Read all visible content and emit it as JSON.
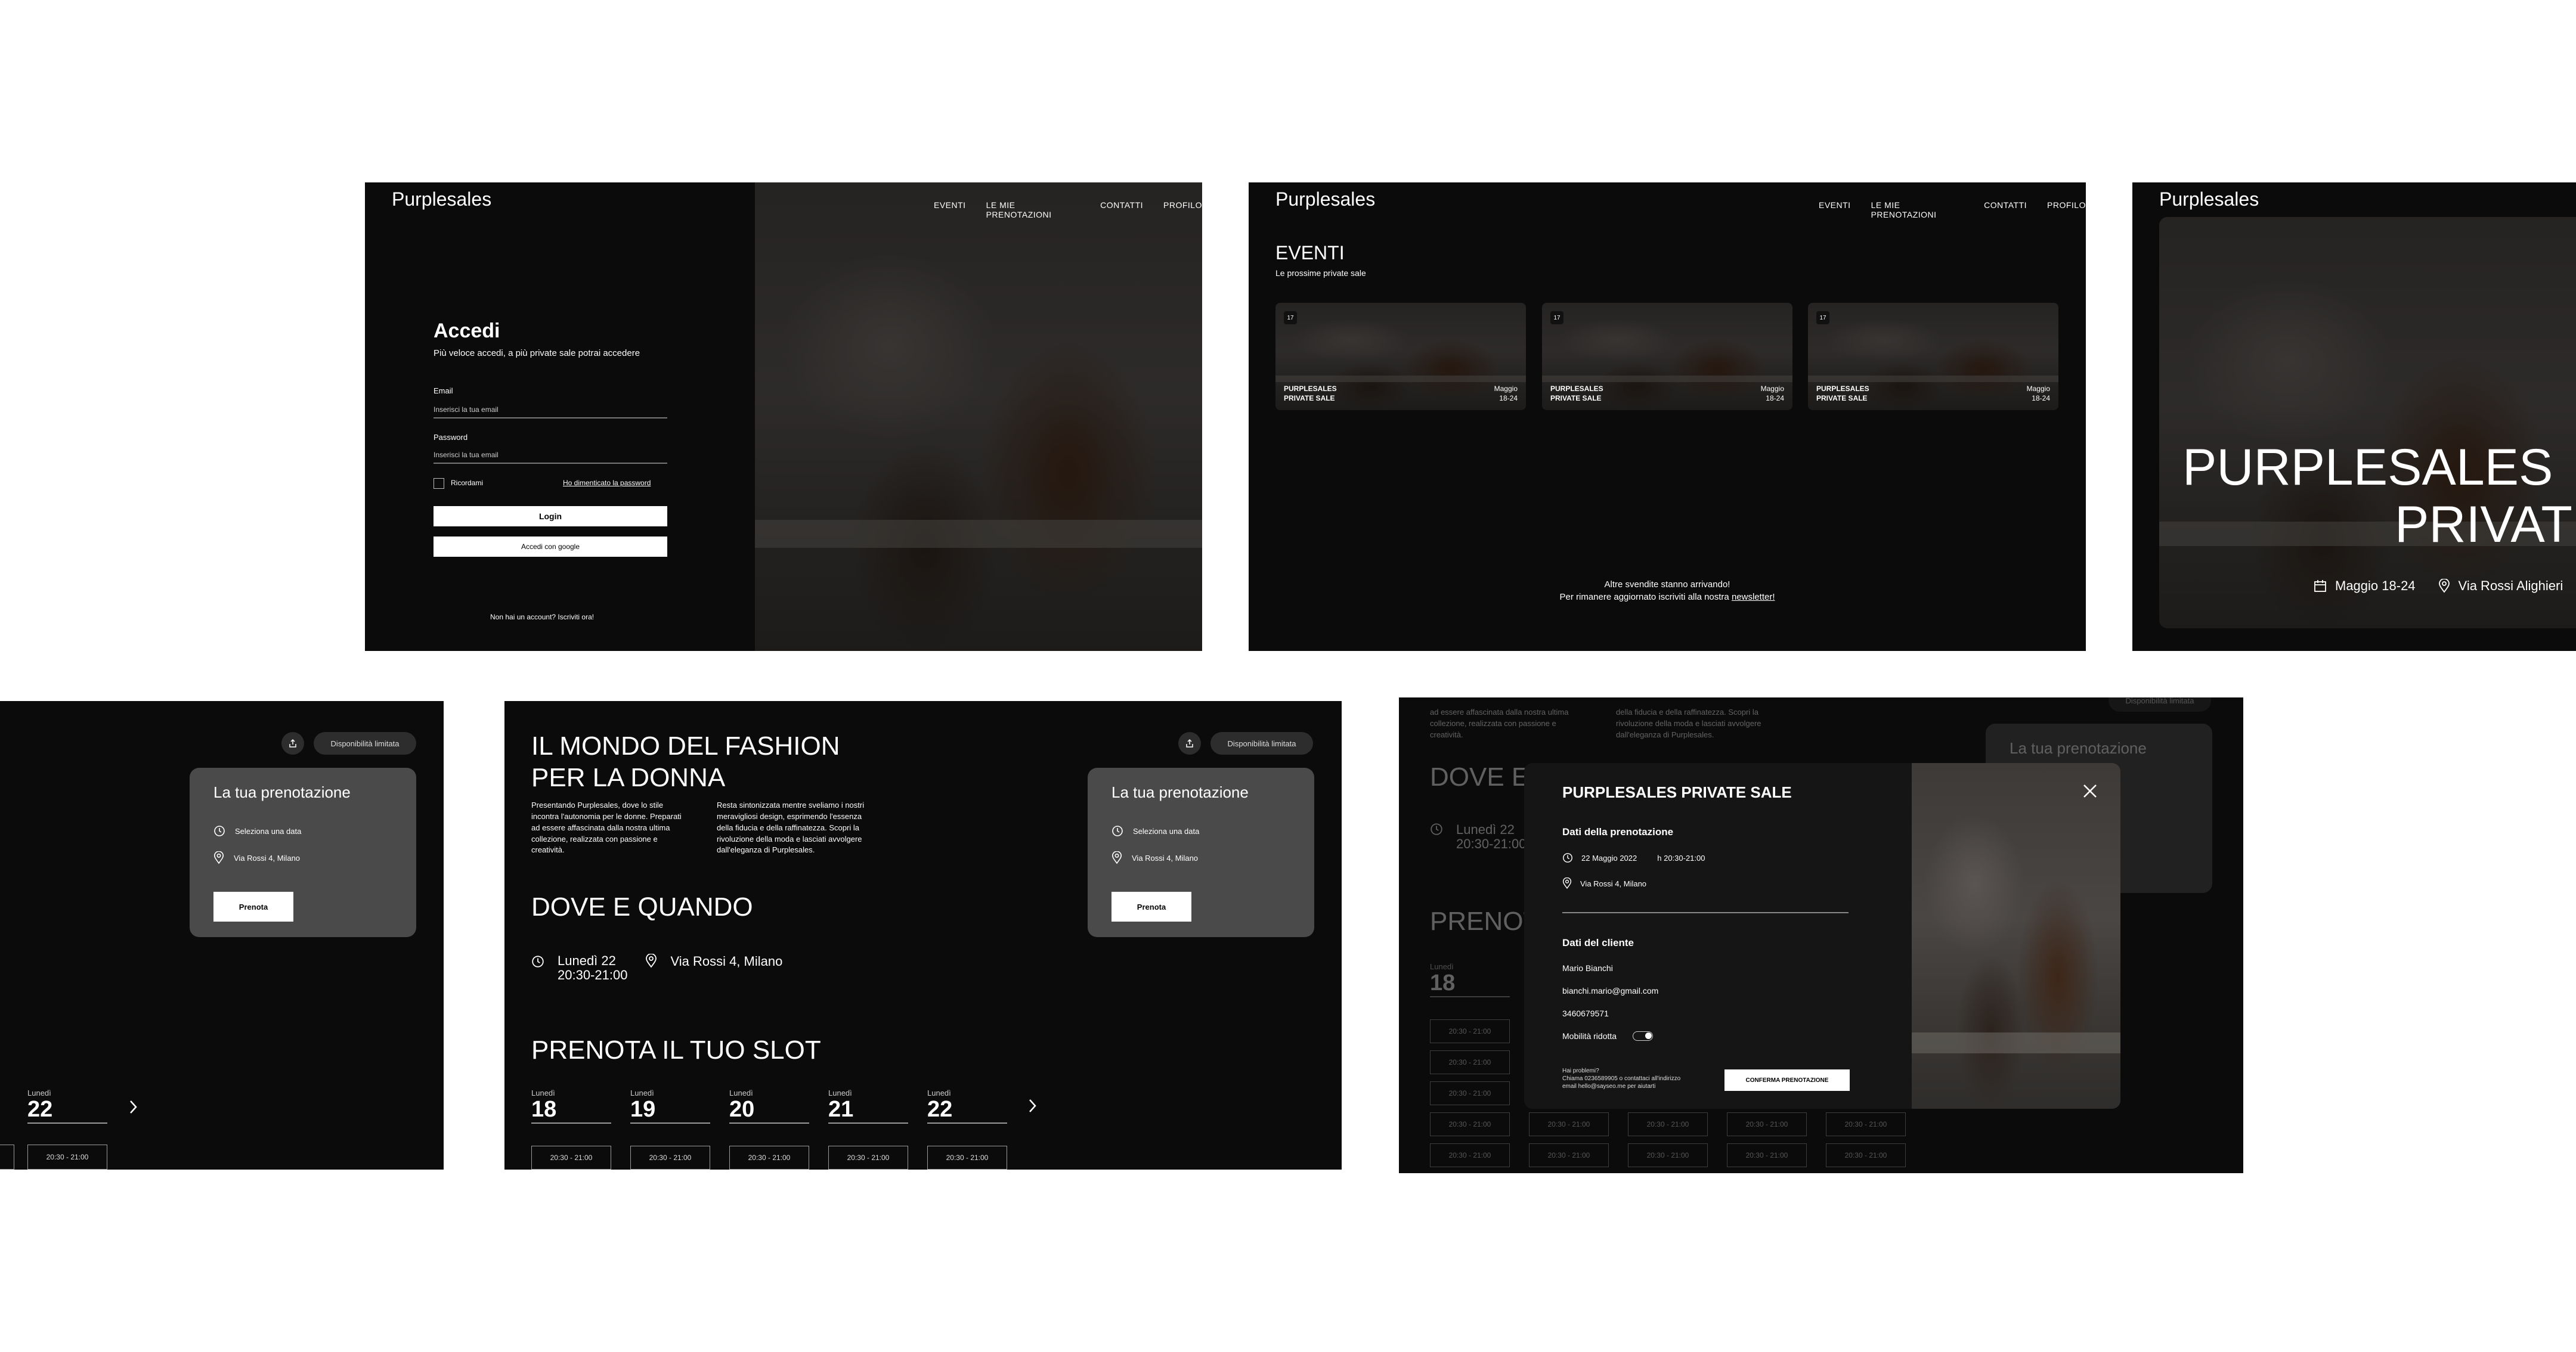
{
  "login": {
    "brand": "Purplesales",
    "nav": [
      "EVENTI",
      "LE MIE PRENOTAZIONI",
      "CONTATTI",
      "PROFILO"
    ],
    "title": "Accedi",
    "subtitle": "Più veloce accedi, a più private sale potrai accedere",
    "email_label": "Email",
    "email_placeholder": "Inserisci la tua email",
    "password_label": "Password",
    "password_placeholder": "Inserisci la tua email",
    "remember": "Ricordami",
    "forgot": "Ho dimenticato la password",
    "login_button": "Login",
    "google_button": "Accedi con google",
    "signup": "Non hai un account? Iscriviti ora!"
  },
  "events": {
    "brand": "Purplesales",
    "nav": [
      "EVENTI",
      "LE MIE PRENOTAZIONI",
      "CONTATTI",
      "PROFILO"
    ],
    "title": "EVENTI",
    "subtitle": "Le prossime private sale",
    "cards": [
      {
        "icon": "17",
        "line1": "PURPLESALES",
        "line2": "PRIVATE SALE",
        "date1": "Maggio",
        "date2": "18-24"
      },
      {
        "icon": "17",
        "line1": "PURPLESALES",
        "line2": "PRIVATE SALE",
        "date1": "Maggio",
        "date2": "18-24"
      },
      {
        "icon": "17",
        "line1": "PURPLESALES",
        "line2": "PRIVATE SALE",
        "date1": "Maggio",
        "date2": "18-24"
      }
    ],
    "footer1": "Altre svendite stanno arrivando!",
    "footer2": "Per rimanere aggiornato iscriviti alla nostra ",
    "footer_link": "newsletter!"
  },
  "hero": {
    "brand": "Purplesales",
    "line1": "PURPLESALES",
    "line2": "PRIVAT",
    "date": "Maggio 18-24",
    "place": "Via Rossi Alighieri"
  },
  "booking_left": {
    "pill": "Disponibilità limitata",
    "card_title": "La tua prenotazione",
    "date_row": "Seleziona una data",
    "place_row": "Via Rossi 4, Milano",
    "button": "Prenota",
    "day_name": "Lunedì",
    "day_num": "22",
    "slot": "20:30 - 21:00"
  },
  "detail": {
    "headline1": "IL MONDO DEL FASHION",
    "headline2": "PER LA DONNA",
    "para1": [
      "Presentando Purplesales, dove lo stile",
      "incontra l'autonomia per le donne. Preparati",
      "ad essere affascinata dalla nostra ultima",
      "collezione, realizzata con passione e",
      "creatività."
    ],
    "para2": [
      "Resta sintonizzata mentre sveliamo i nostri",
      "meravigliosi design, esprimendo l'essenza",
      "della fiducia e della raffinatezza. Scopri la",
      "rivoluzione della moda e lasciati avvolgere",
      "dall'eleganza di Purplesales."
    ],
    "where_title": "DOVE E QUANDO",
    "when1": "Lunedì 22",
    "when2": "20:30-21:00",
    "where": "Via Rossi 4, Milano",
    "slot_title": "PRENOTA IL TUO SLOT",
    "days": [
      {
        "name": "Lunedì",
        "num": "18"
      },
      {
        "name": "Lunedì",
        "num": "19"
      },
      {
        "name": "Lunedì",
        "num": "20"
      },
      {
        "name": "Lunedì",
        "num": "21"
      },
      {
        "name": "Lunedì",
        "num": "22"
      }
    ],
    "slot": "20:30 - 21:00",
    "pill": "Disponibilità limitata",
    "card_title": "La tua prenotazione",
    "date_row": "Seleziona una data",
    "place_row": "Via Rossi 4, Milano",
    "button": "Prenota"
  },
  "modal_bg": {
    "para1": [
      "ad essere affascinata dalla nostra ultima",
      "collezione, realizzata con passione e",
      "creatività."
    ],
    "para2": [
      "della fiducia e della raffinatezza. Scopri la",
      "rivoluzione della moda e lasciati avvolgere",
      "dall'eleganza di Purplesales."
    ],
    "where_title": "DOVE E",
    "when1": "Lunedì 22",
    "when2": "20:30-21:00",
    "slot_title": "PRENOT",
    "day_name": "Lunedì",
    "day_num": "18",
    "slot": "20:30 - 21:00",
    "card_title": "La tua prenotazione",
    "pill": "Disponibilità limitata"
  },
  "modal": {
    "title": "PURPLESALES PRIVATE SALE",
    "booking_section": "Dati della prenotazione",
    "date": "22 Maggio 2022",
    "time": "h 20:30-21:00",
    "place": "Via Rossi 4, Milano",
    "client_section": "Dati del cliente",
    "name": "Mario Bianchi",
    "email": "bianchi.mario@gmail.com",
    "phone": "3460679571",
    "mobility": "Mobilità ridotta",
    "help1": "Hai problemi?",
    "help2": "Chiama 0236589905 o contattaci all'indirizzo",
    "help3": "email hello@sayseo.me per aiutarti",
    "confirm": "CONFERMA PRENOTAZIONE"
  }
}
